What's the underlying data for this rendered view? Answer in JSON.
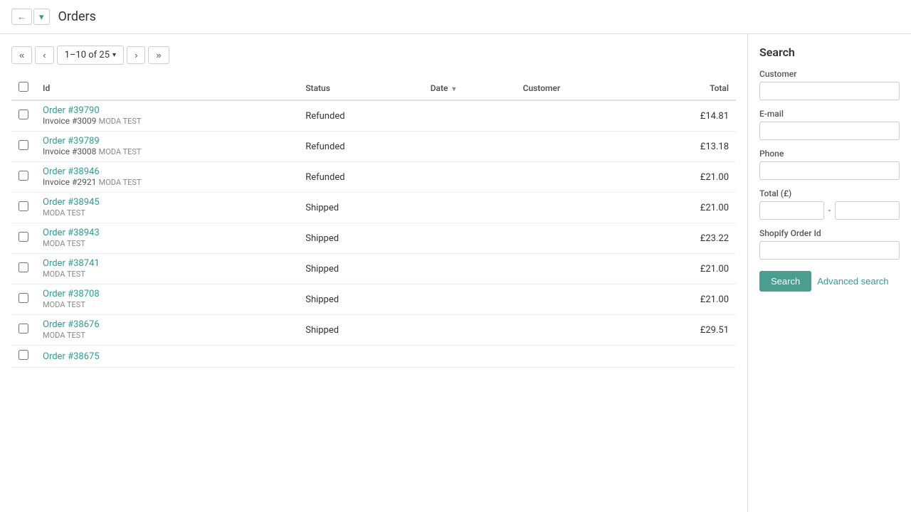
{
  "header": {
    "title": "Orders",
    "back_label": "←",
    "dropdown_label": "▾"
  },
  "pagination": {
    "range": "1–10 of 25",
    "first_label": "«",
    "prev_label": "‹",
    "next_label": "›",
    "last_label": "»"
  },
  "table": {
    "columns": [
      {
        "key": "id",
        "label": "Id"
      },
      {
        "key": "status",
        "label": "Status"
      },
      {
        "key": "date",
        "label": "Date",
        "sorted": true
      },
      {
        "key": "customer",
        "label": "Customer"
      },
      {
        "key": "total",
        "label": "Total"
      }
    ],
    "rows": [
      {
        "order": "Order #39790",
        "invoice": "Invoice #3009",
        "customer": "MODA TEST",
        "status": "Refunded",
        "date": "",
        "total": "£14.81"
      },
      {
        "order": "Order #39789",
        "invoice": "Invoice #3008",
        "customer": "MODA TEST",
        "status": "Refunded",
        "date": "",
        "total": "£13.18"
      },
      {
        "order": "Order #38946",
        "invoice": "Invoice #2921",
        "customer": "MODA TEST",
        "status": "Refunded",
        "date": "",
        "total": "£21.00"
      },
      {
        "order": "Order #38945",
        "invoice": "",
        "customer": "MODA TEST",
        "status": "Shipped",
        "date": "",
        "total": "£21.00"
      },
      {
        "order": "Order #38943",
        "invoice": "",
        "customer": "MODA TEST",
        "status": "Shipped",
        "date": "",
        "total": "£23.22"
      },
      {
        "order": "Order #38741",
        "invoice": "",
        "customer": "MODA TEST",
        "status": "Shipped",
        "date": "",
        "total": "£21.00"
      },
      {
        "order": "Order #38708",
        "invoice": "",
        "customer": "MODA TEST",
        "status": "Shipped",
        "date": "",
        "total": "£21.00"
      },
      {
        "order": "Order #38676",
        "invoice": "",
        "customer": "MODA TEST",
        "status": "Shipped",
        "date": "",
        "total": "£29.51"
      },
      {
        "order": "Order #38675",
        "invoice": "",
        "customer": "",
        "status": "",
        "date": "",
        "total": ""
      }
    ]
  },
  "search": {
    "title": "Search",
    "fields": {
      "customer_label": "Customer",
      "customer_placeholder": "",
      "email_label": "E-mail",
      "email_placeholder": "",
      "phone_label": "Phone",
      "phone_placeholder": "",
      "total_label": "Total (£)",
      "total_from_placeholder": "",
      "total_to_placeholder": "",
      "shopify_label": "Shopify Order Id",
      "shopify_placeholder": ""
    },
    "search_btn": "Search",
    "advanced_btn": "Advanced search"
  }
}
